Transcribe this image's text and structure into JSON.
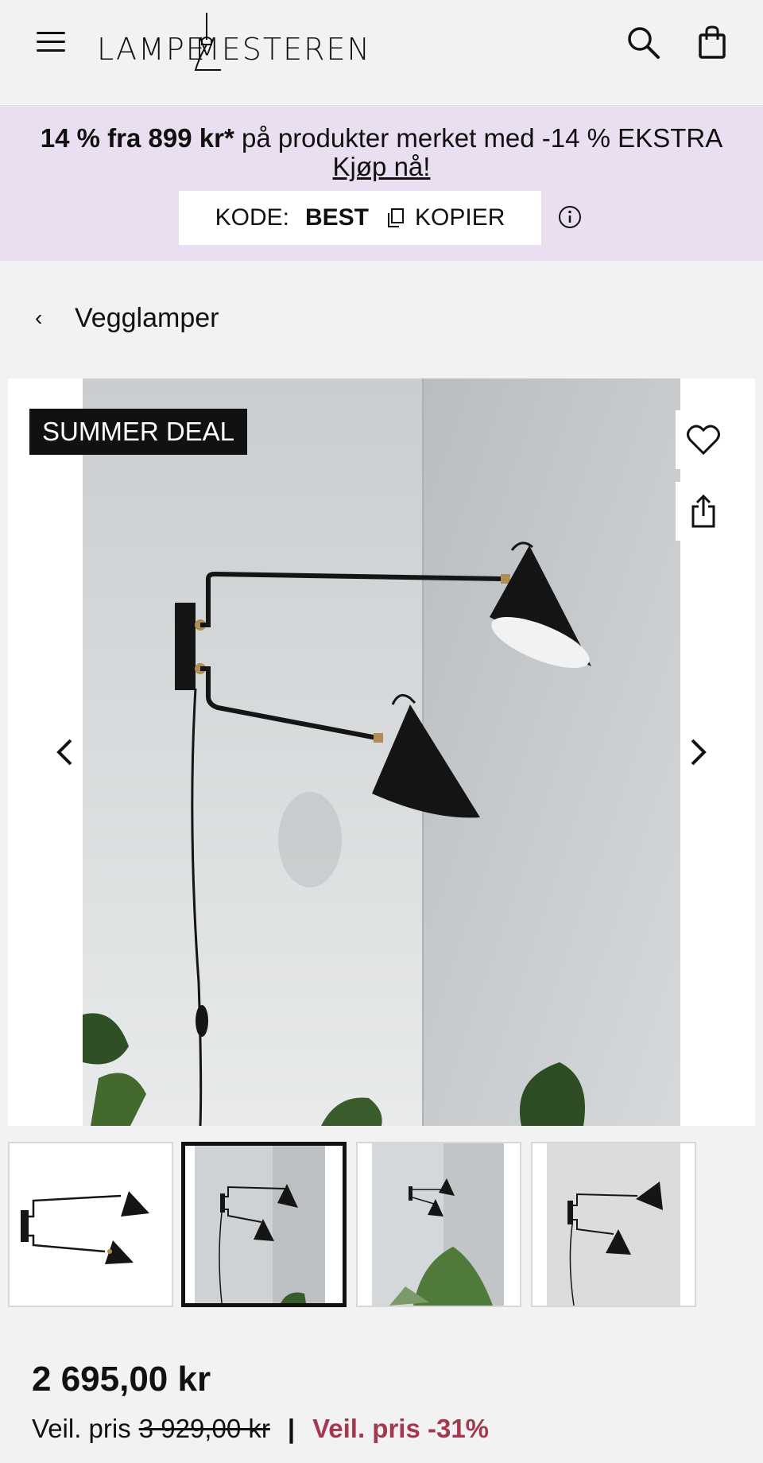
{
  "header": {
    "logo_left": "LAMPE",
    "logo_right": "MESTEREN"
  },
  "promo": {
    "bold_part": "14 % fra 899 kr*",
    "rest_part": " på produkter merket med -14 % EKSTRA  ",
    "link": "Kjøp nå!",
    "code_label": "KODE:",
    "code": "BEST",
    "copy_label": "KOPIER"
  },
  "breadcrumb": {
    "label": "Vegglamper"
  },
  "gallery": {
    "badge": "SUMMER DEAL"
  },
  "thumbnails": {
    "count": 4,
    "active_index": 1
  },
  "price": {
    "current": "2 695,00 kr",
    "compare_label": "Veil. pris",
    "compare_value": "3 929,00 kr",
    "separator": "|",
    "discount": "Veil. pris -31%"
  },
  "colors": {
    "promo_bg": "#eadff0",
    "discount": "#a2394f",
    "badge_bg": "#111111"
  }
}
